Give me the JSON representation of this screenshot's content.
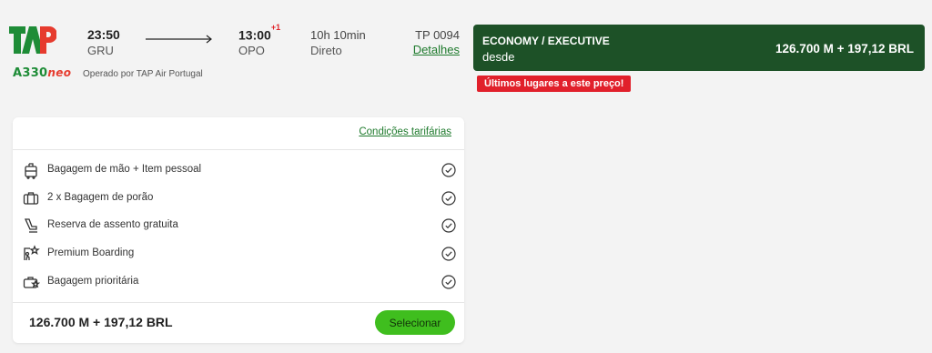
{
  "airline": {
    "logo_text": "TAP",
    "aircraft_model": "A330",
    "aircraft_variant": "neo",
    "operated_by": "Operado por TAP Air Portugal"
  },
  "flight": {
    "departure_time": "23:50",
    "departure_airport": "GRU",
    "arrival_time": "13:00",
    "arrival_day_offset": "+1",
    "arrival_airport": "OPO",
    "duration": "10h 10min",
    "stops": "Direto",
    "flight_number": "TP 0094",
    "details_label": "Detalhes"
  },
  "fare": {
    "class_name": "ECONOMY / EXECUTIVE",
    "from_label": "desde",
    "price": "126.700 M + 197,12 BRL",
    "badge": "Últimos lugares a este preço!"
  },
  "card": {
    "conditions_label": "Condições tarifárias",
    "features": [
      {
        "label": "Bagagem de mão + Item pessoal",
        "icon": "carry-on-bag-icon"
      },
      {
        "label": "2 x Bagagem de porão",
        "icon": "checked-bag-icon"
      },
      {
        "label": "Reserva de assento gratuita",
        "icon": "seat-icon"
      },
      {
        "label": "Premium Boarding",
        "icon": "premium-boarding-icon"
      },
      {
        "label": "Bagagem prioritária",
        "icon": "priority-bag-icon"
      }
    ],
    "total_price": "126.700 M + 197,12 BRL",
    "select_label": "Selecionar"
  },
  "colors": {
    "tap_green": "#1e8c37",
    "tap_red": "#e63b2e",
    "fare_banner_bg": "#1d5127",
    "badge_bg": "#e1202b",
    "select_button_bg": "#3fbe1e",
    "link_color": "#1e7a2c"
  }
}
